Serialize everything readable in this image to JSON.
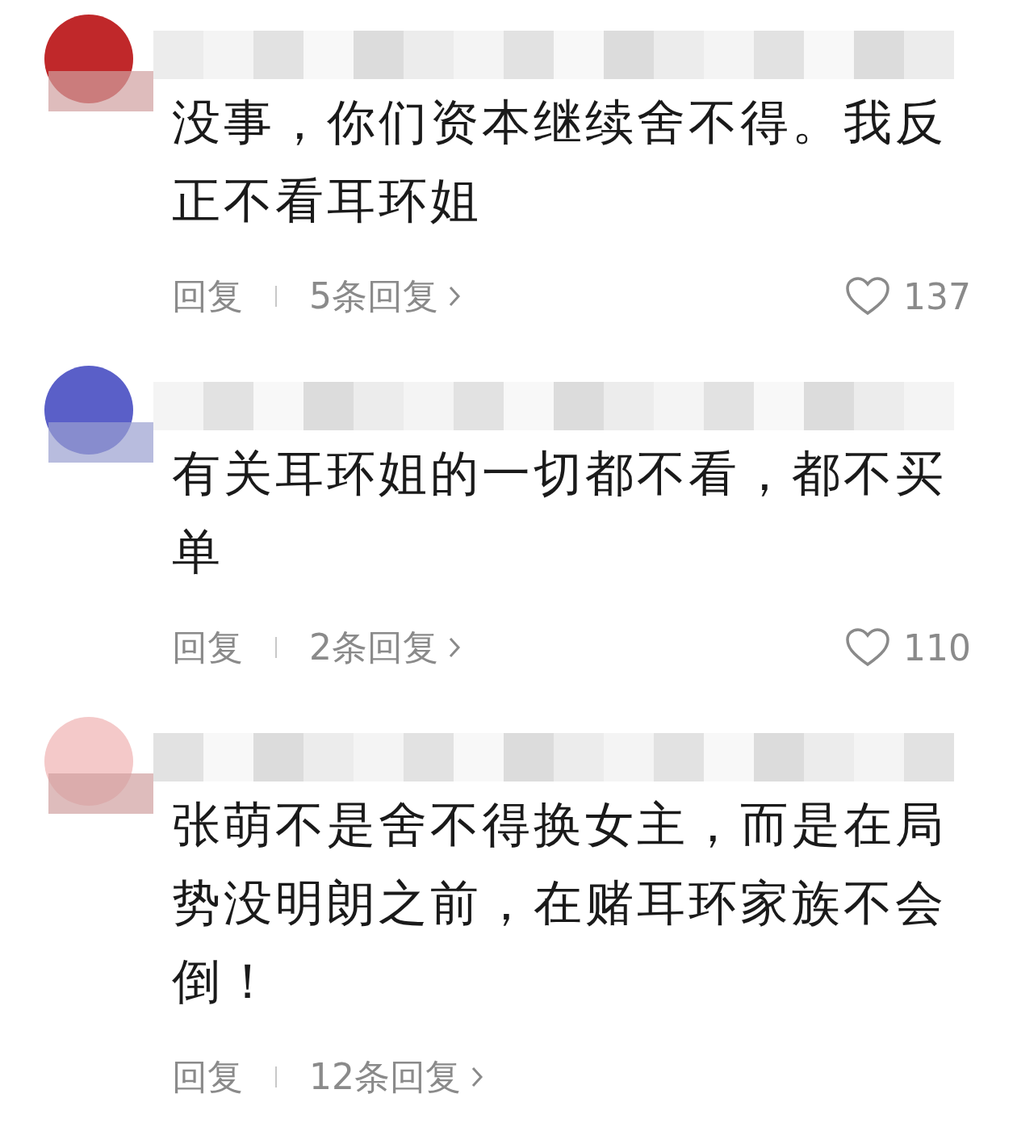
{
  "comments": [
    {
      "color": "#c0282a",
      "text": "没事，你们资本继续舍不得。我反正不看耳环姐",
      "reply_label": "回复",
      "replies": "5条回复",
      "likes": "137"
    },
    {
      "color": "#5a5fc8",
      "text": "有关耳环姐的一切都不看，都不买单",
      "reply_label": "回复",
      "replies": "2条回复",
      "likes": "110"
    },
    {
      "color": "#f4c9c9",
      "text": "张萌不是舍不得换女主，而是在局势没明朗之前，在赌耳环家族不会倒！",
      "reply_label": "回复",
      "replies": "12条回复"
    }
  ]
}
